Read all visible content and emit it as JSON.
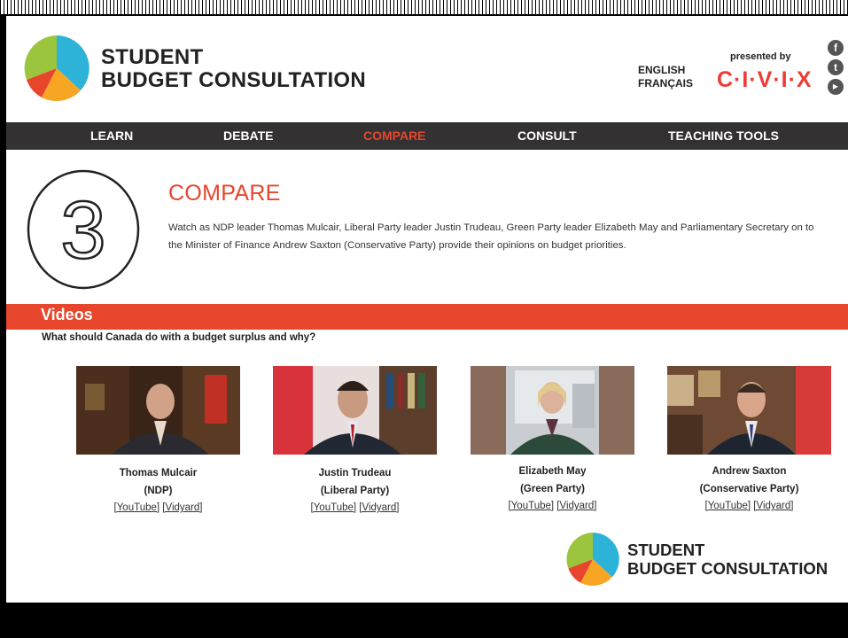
{
  "brand": {
    "line1": "STUDENT",
    "line2": "BUDGET CONSULTATION"
  },
  "language": {
    "english": "ENGLISH",
    "french": "FRANÇAIS"
  },
  "sponsor": {
    "presented_by": "presented by",
    "name": "C·I·V·I·X"
  },
  "social": [
    "facebook-icon",
    "twitter-icon",
    "youtube-icon"
  ],
  "nav": [
    {
      "label": "LEARN",
      "active": false
    },
    {
      "label": "DEBATE",
      "active": false
    },
    {
      "label": "COMPARE",
      "active": true
    },
    {
      "label": "CONSULT",
      "active": false
    },
    {
      "label": "TEACHING TOOLS",
      "active": false
    }
  ],
  "hero": {
    "step": "3",
    "title": "COMPARE",
    "text": "Watch as NDP leader Thomas Mulcair, Liberal Party leader Justin Trudeau, Green Party leader Elizabeth May and Parliamentary Secretary on to the Minister of Finance Andrew Saxton (Conservative Party) provide their opinions on budget priorities."
  },
  "videos": {
    "title": "Videos",
    "question": "What should Canada do with a budget surplus and why?",
    "items": [
      {
        "name": "Thomas Mulcair",
        "party": "(NDP)",
        "youtube": "[YouTube]",
        "vidyard": "[Vidyard]"
      },
      {
        "name": "Justin Trudeau",
        "party": "(Liberal Party)",
        "youtube": "[YouTube]",
        "vidyard": "[Vidyard]"
      },
      {
        "name": "Elizabeth May",
        "party": "(Green Party)",
        "youtube": "[YouTube]",
        "vidyard": "[Vidyard]"
      },
      {
        "name": "Andrew Saxton",
        "party": "(Conservative Party)",
        "youtube": "[YouTube]",
        "vidyard": "[Vidyard]"
      }
    ]
  },
  "colors": {
    "accent": "#e8452d",
    "nav_bg": "#333132",
    "pie_green": "#9bc53d",
    "pie_blue": "#2db3d8",
    "pie_orange": "#f6a623",
    "pie_red": "#e8452d"
  }
}
